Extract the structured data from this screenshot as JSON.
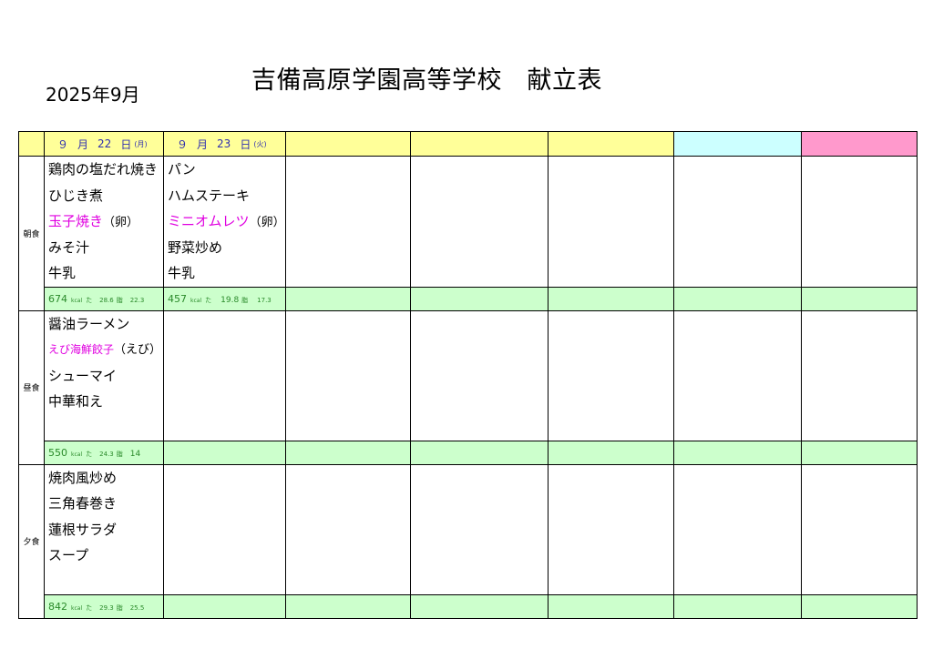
{
  "header": {
    "month": "2025年9月",
    "title": "吉備高原学園高等学校　献立表"
  },
  "days": [
    {
      "month": "９",
      "month_unit": "月",
      "day": "22",
      "day_unit": "日",
      "weekday": "(月)"
    },
    {
      "month": "９",
      "month_unit": "月",
      "day": "23",
      "day_unit": "日",
      "weekday": "(火)"
    }
  ],
  "meals": {
    "breakfast": {
      "label": "朝食",
      "day1": [
        "鶏肉の塩だれ焼き",
        "ひじき煮",
        "玉子焼き",
        "みそ汁",
        "牛乳"
      ],
      "day1_allergen": "（卵）",
      "day2": [
        "パン",
        "ハムステーキ",
        "ミニオムレツ",
        "野菜炒め",
        "牛乳"
      ],
      "day2_allergen": "（卵）",
      "nut1": {
        "kcal": "674",
        "kcal_unit": "kcal",
        "p_label": "た",
        "p": "28.6",
        "f_label": "脂",
        "f": "22.3"
      },
      "nut2": {
        "kcal": "457",
        "kcal_unit": "kcal",
        "p_label": "た",
        "p": "19.8",
        "f_label": "脂",
        "f": "17.3"
      }
    },
    "lunch": {
      "label": "昼食",
      "day1": [
        "醤油ラーメン",
        "えび海鮮餃子",
        "シューマイ",
        "中華和え"
      ],
      "day1_allergen": "（えび）",
      "nut1": {
        "kcal": "550",
        "kcal_unit": "kcal",
        "p_label": "た",
        "p": "24.3",
        "f_label": "脂",
        "f": "14"
      }
    },
    "dinner": {
      "label": "夕食",
      "day1": [
        "焼肉風炒め",
        "三角春巻き",
        "蓮根サラダ",
        "スープ"
      ],
      "nut1": {
        "kcal": "842",
        "kcal_unit": "kcal",
        "p_label": "た",
        "p": "29.3",
        "f_label": "脂",
        "f": "25.5"
      }
    }
  },
  "colors": {
    "header_yellow": "#ffff99",
    "header_cyan": "#ccffff",
    "header_pink": "#ff99cc",
    "nutrition_green": "#ccffcc",
    "allergen_magenta": "#e000e0",
    "date_text_blue": "#2f2fb0",
    "nutrition_text_green": "#2a8a2a"
  }
}
